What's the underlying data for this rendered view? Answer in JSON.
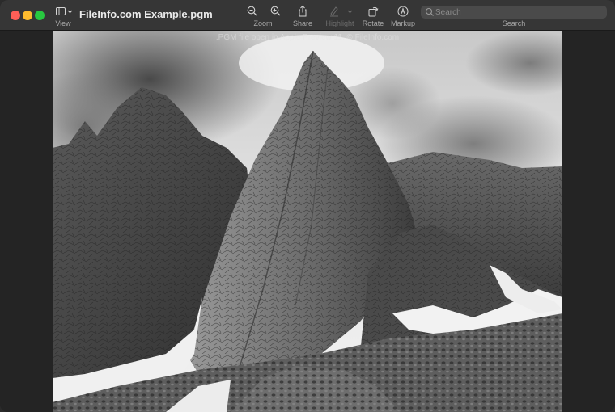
{
  "window": {
    "title": "FileInfo.com Example.pgm"
  },
  "toolbar": {
    "view_label": "View",
    "zoom_label": "Zoom",
    "share_label": "Share",
    "highlight_label": "Highlight",
    "rotate_label": "Rotate",
    "markup_label": "Markup",
    "search_label": "Search",
    "search_placeholder": "Search"
  },
  "document": {
    "watermark": ".PGM file open in Apple Preview 11. © FileInfo.com"
  },
  "colors": {
    "close": "#fe5f57",
    "minimize": "#febc2e",
    "maximize": "#28c840"
  }
}
